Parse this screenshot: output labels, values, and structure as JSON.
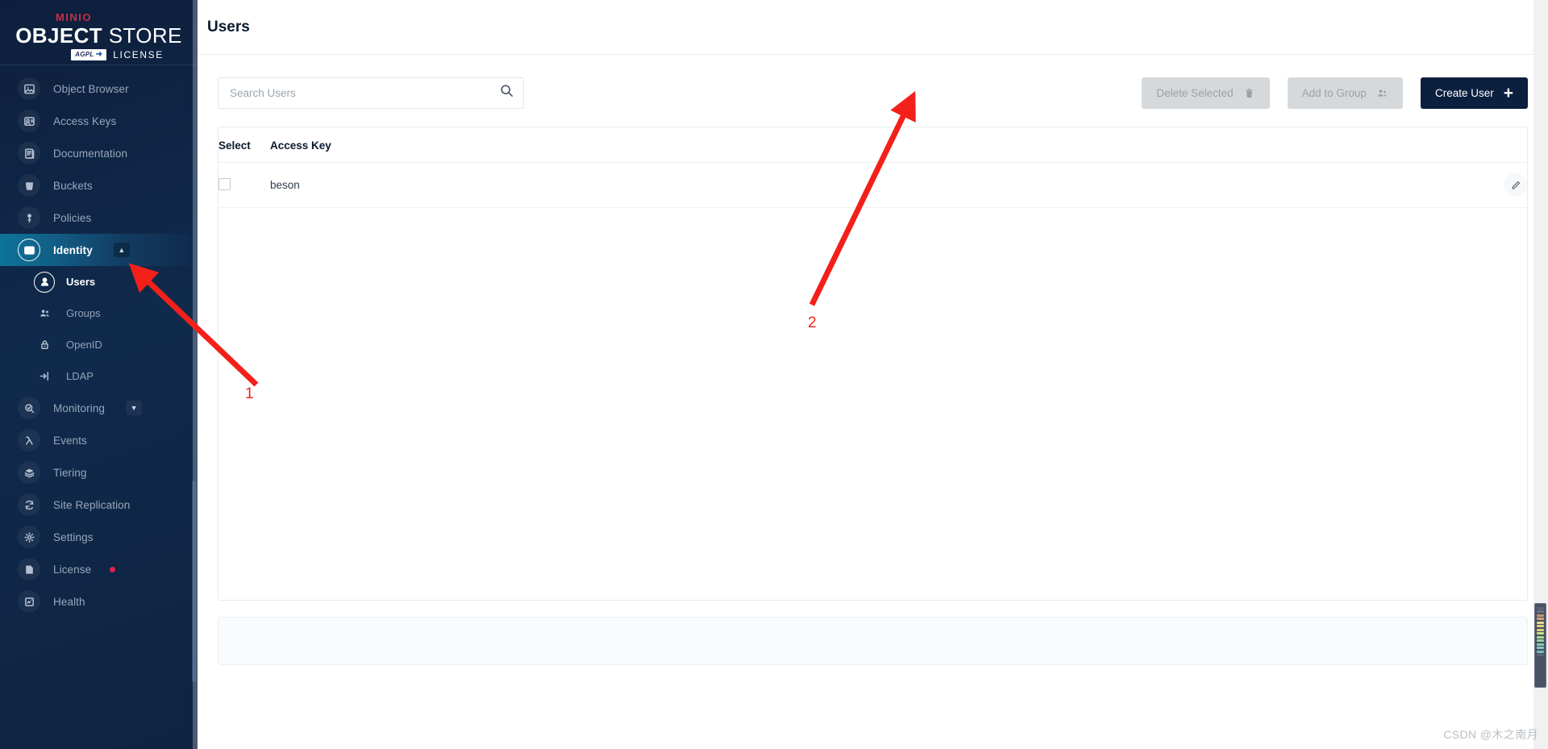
{
  "brand": {
    "minio": "MINIO",
    "object": "OBJECT",
    "store": "STORE",
    "badge": "AGPL",
    "license": "LICENSE"
  },
  "sidebar": {
    "items": [
      {
        "label": "Object Browser",
        "icon": "image-browser-icon",
        "type": "item"
      },
      {
        "label": "Access Keys",
        "icon": "id-card-icon",
        "type": "item"
      },
      {
        "label": "Documentation",
        "icon": "book-icon",
        "type": "item"
      },
      {
        "label": "Buckets",
        "icon": "bucket-icon",
        "type": "item"
      },
      {
        "label": "Policies",
        "icon": "policy-lock-icon",
        "type": "item"
      },
      {
        "label": "Identity",
        "icon": "identity-card-icon",
        "type": "group",
        "expanded": true,
        "active": true,
        "chevron": "chevron-up-icon"
      },
      {
        "label": "Users",
        "icon": "user-icon",
        "type": "sub",
        "active": true
      },
      {
        "label": "Groups",
        "icon": "users-group-icon",
        "type": "sub",
        "active": false
      },
      {
        "label": "OpenID",
        "icon": "lock-icon",
        "type": "sub",
        "active": false
      },
      {
        "label": "LDAP",
        "icon": "login-arrow-icon",
        "type": "sub",
        "active": false
      },
      {
        "label": "Monitoring",
        "icon": "monitor-search-icon",
        "type": "group",
        "expanded": false,
        "active": false,
        "chevron": "chevron-down-icon"
      },
      {
        "label": "Events",
        "icon": "lambda-icon",
        "type": "item"
      },
      {
        "label": "Tiering",
        "icon": "layers-icon",
        "type": "item"
      },
      {
        "label": "Site Replication",
        "icon": "replication-icon",
        "type": "item"
      },
      {
        "label": "Settings",
        "icon": "gear-icon",
        "type": "item"
      },
      {
        "label": "License",
        "icon": "license-doc-icon",
        "type": "item",
        "badge_dot": true
      },
      {
        "label": "Health",
        "icon": "health-icon",
        "type": "item"
      }
    ]
  },
  "header": {
    "title": "Users"
  },
  "toolbar": {
    "search_placeholder": "Search Users",
    "search_value": "",
    "search_icon": "search-icon",
    "delete_selected_label": "Delete Selected",
    "delete_selected_icon": "trash-icon",
    "delete_selected_disabled": true,
    "add_to_group_label": "Add to Group",
    "add_to_group_icon": "users-group-icon",
    "add_to_group_disabled": true,
    "create_user_label": "Create User",
    "create_user_icon": "plus-icon"
  },
  "table": {
    "columns": [
      "Select",
      "Access Key"
    ],
    "rows": [
      {
        "selected": false,
        "access_key": "beson",
        "action_icon": "edit-pencil-icon"
      }
    ]
  },
  "annotations": [
    {
      "number": "1",
      "target": "sidebar-item-users"
    },
    {
      "number": "2",
      "target": "create-user-button"
    }
  ],
  "colors": {
    "brand_red": "#c72e49",
    "primary_navy": "#0b1f3f",
    "annotation_red": "#f3201a",
    "active_teal": "#0e7499",
    "badge_red": "#e0224a"
  },
  "watermark": {
    "text": "CSDN @木之南月"
  }
}
